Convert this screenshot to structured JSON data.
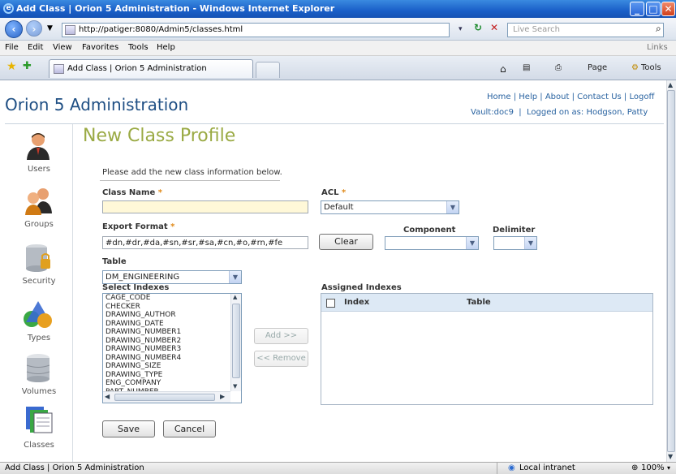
{
  "window": {
    "title": "Add Class | Orion 5 Administration - Windows Internet Explorer"
  },
  "browser": {
    "address": "http://patiger:8080/Admin5/classes.html",
    "search_placeholder": "Live Search",
    "menu": [
      "File",
      "Edit",
      "View",
      "Favorites",
      "Tools",
      "Help"
    ],
    "links_label": "Links",
    "tab_title": "Add Class | Orion 5 Administration",
    "toolbar": {
      "page": "Page",
      "tools": "Tools"
    }
  },
  "header": {
    "app_title": "Orion 5 Administration",
    "links": [
      "Home",
      "Help",
      "About",
      "Contact Us",
      "Logoff"
    ],
    "vault": "Vault:doc9",
    "logged_on": "Logged on as: Hodgson, Patty"
  },
  "sidebar": {
    "items": [
      "Users",
      "Groups",
      "Security",
      "Types",
      "Volumes",
      "Classes"
    ]
  },
  "form": {
    "page_title": "New Class Profile",
    "intro": "Please add the new class information below.",
    "class_name_label": "Class Name",
    "class_name_value": "",
    "acl_label": "ACL",
    "acl_value": "Default",
    "export_format_label": "Export Format",
    "export_format_value": "#dn,#dr,#da,#sn,#sr,#sa,#cn,#o,#rn,#fe",
    "clear_label": "Clear",
    "component_label": "Component",
    "component_value": "",
    "delimiter_label": "Delimiter",
    "delimiter_value": "",
    "table_label": "Table",
    "table_value": "DM_ENGINEERING",
    "select_indexes_label": "Select Indexes",
    "indexes": [
      "CAGE_CODE",
      "CHECKER",
      "DRAWING_AUTHOR",
      "DRAWING_DATE",
      "DRAWING_NUMBER1",
      "DRAWING_NUMBER2",
      "DRAWING_NUMBER3",
      "DRAWING_NUMBER4",
      "DRAWING_SIZE",
      "DRAWING_TYPE",
      "ENG_COMPANY",
      "PART_NUMBER"
    ],
    "add_label": "Add >>",
    "remove_label": "<< Remove",
    "assigned_label": "Assigned Indexes",
    "col_index": "Index",
    "col_table": "Table",
    "save_label": "Save",
    "cancel_label": "Cancel"
  },
  "status": {
    "text": "Add Class | Orion 5 Administration",
    "zone": "Local intranet",
    "zoom": "100%"
  }
}
